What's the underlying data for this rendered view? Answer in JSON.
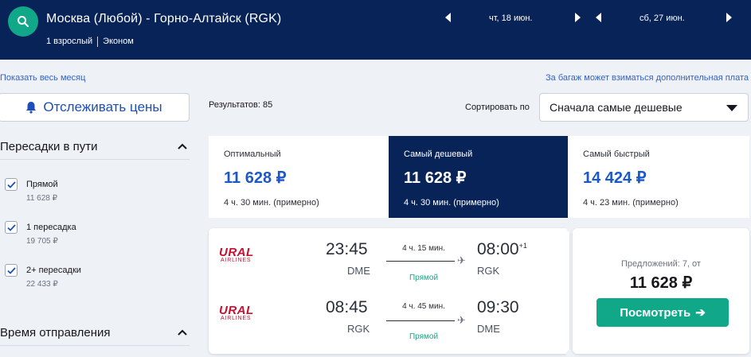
{
  "header": {
    "route": "Москва (Любой) - Горно-Алтайск (RGK)",
    "passengers": "1 взрослый",
    "cabin": "Эконом",
    "date_out": "чт, 18 июн.",
    "date_back": "сб, 27 июн."
  },
  "links": {
    "show_month": "Показать весь месяц",
    "baggage_note": "За багаж может взиматься дополнительная плата"
  },
  "sidebar": {
    "track_label": "Отслеживать цены",
    "stops_title": "Пересадки в пути",
    "stops": [
      {
        "label": "Прямой",
        "price": "11 628 ₽",
        "checked": true
      },
      {
        "label": "1 пересадка",
        "price": "19 705 ₽",
        "checked": true
      },
      {
        "label": "2+ пересадки",
        "price": "22 433 ₽",
        "checked": true
      }
    ],
    "departure_title": "Время отправления"
  },
  "results": {
    "count_label": "Результатов: 85",
    "sort_label": "Сортировать по",
    "sort_value": "Сначала самые дешевые"
  },
  "tabs": [
    {
      "label": "Оптимальный",
      "price": "11 628 ₽",
      "duration": "4 ч. 30 мин. (примерно)",
      "active": false
    },
    {
      "label": "Самый дешевый",
      "price": "11 628 ₽",
      "duration": "4 ч. 30 мин. (примерно)",
      "active": true
    },
    {
      "label": "Самый быстрый",
      "price": "14 424 ₽",
      "duration": "4 ч. 23 мин. (примерно)",
      "active": false
    }
  ],
  "ticket": {
    "airline_logo_top": "URAL",
    "airline_logo_bottom": "AIRLINES",
    "outbound": {
      "dep_time": "23:45",
      "dep_code": "DME",
      "duration": "4 ч. 15 мин.",
      "stops": "Прямой",
      "arr_time": "08:00",
      "arr_plus": "+1",
      "arr_code": "RGK"
    },
    "inbound": {
      "dep_time": "08:45",
      "dep_code": "RGK",
      "duration": "4 ч. 45 мин.",
      "stops": "Прямой",
      "arr_time": "09:30",
      "arr_code": "DME"
    },
    "offers": "Предложений: 7, от",
    "price": "11 628 ₽",
    "view_label": "Посмотреть",
    "view_arrow": "➔"
  },
  "colors": {
    "header_bg": "#082357",
    "accent_green": "#10a889",
    "price_blue": "#1d58c8",
    "airline_red": "#c8102e"
  }
}
